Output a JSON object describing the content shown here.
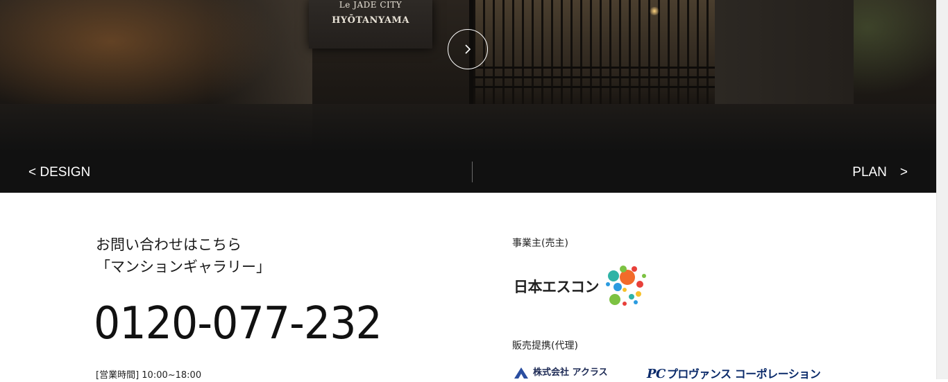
{
  "hero": {
    "sign_line1": "Le JADE CITY",
    "sign_line2": "HYŌTANYAMA",
    "next_icon": "chevron-right-icon"
  },
  "nav": {
    "prev_label": "< DESIGN",
    "next_label": "PLAN　>"
  },
  "contact": {
    "heading_line1": "お問い合わせはこちら",
    "heading_line2": "「マンションギャラリー」",
    "phone": "0120-077-232",
    "hours": "[営業時間] 10:00~18:00"
  },
  "companies": {
    "developer_label": "事業主(売主)",
    "developer_logo_text": "日本エスコン",
    "sales_label": "販売提携(代理)",
    "sales_logo1_text": "株式会社 アクラス",
    "sales_logo2_mark": "PC",
    "sales_logo2_text": "プロヴァンス コーポレーション"
  },
  "colors": {
    "nav_bg": "#111111",
    "text": "#111111",
    "esucon_dots": [
      "#2fb3a6",
      "#f26b2a",
      "#7cc242",
      "#e8403a",
      "#2b9be0",
      "#f7c12a"
    ]
  }
}
